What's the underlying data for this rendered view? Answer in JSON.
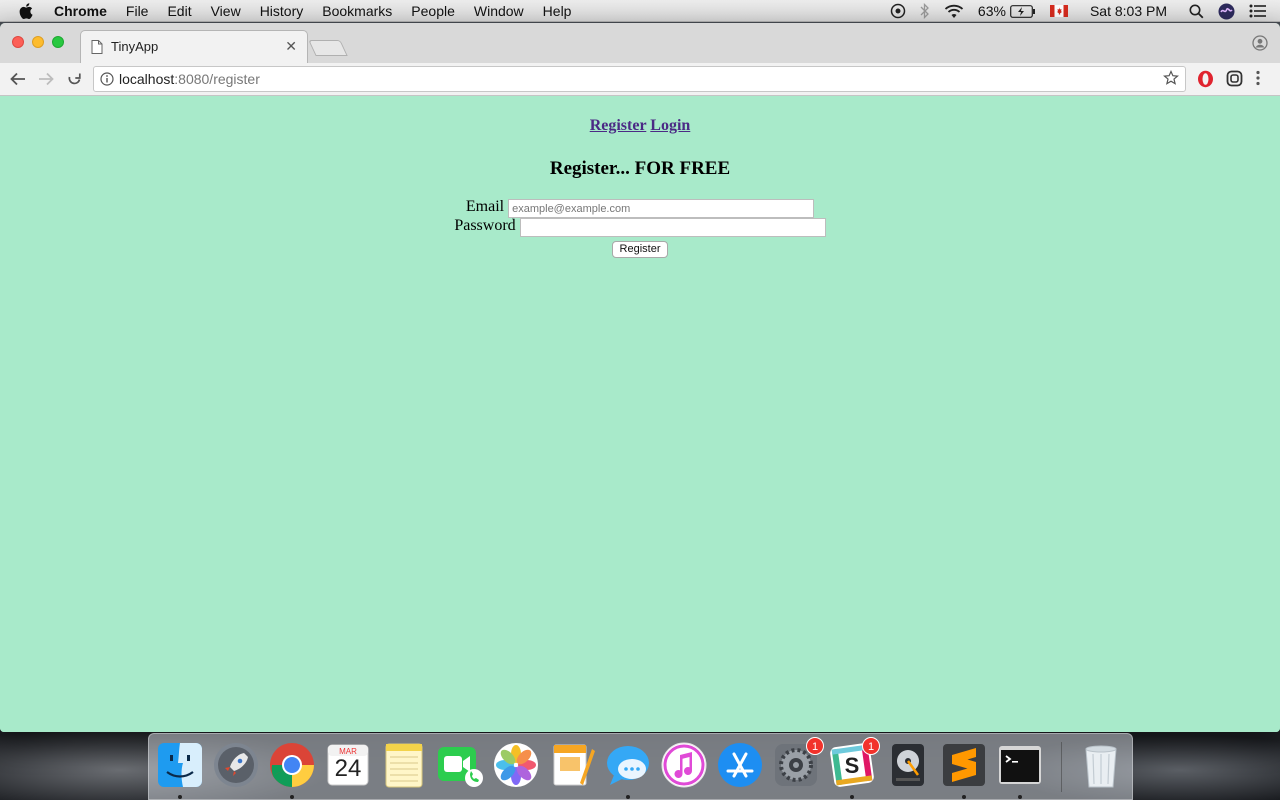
{
  "menubar": {
    "app_name": "Chrome",
    "items": [
      "File",
      "Edit",
      "View",
      "History",
      "Bookmarks",
      "People",
      "Window",
      "Help"
    ],
    "battery": "63%",
    "clock": "Sat 8:03 PM"
  },
  "browser": {
    "tab_title": "TinyApp",
    "url_host": "localhost",
    "url_path": ":8080/register"
  },
  "page": {
    "nav": {
      "register_link": "Register",
      "login_link": "Login"
    },
    "heading": "Register... FOR FREE",
    "form": {
      "email_label": "Email",
      "email_placeholder": "example@example.com",
      "email_value": "",
      "password_label": "Password",
      "password_value": "",
      "submit_label": "Register"
    }
  },
  "dock": {
    "calendar_month": "MAR",
    "calendar_day": "24",
    "badges": {
      "system_preferences": "1",
      "slack": "1"
    },
    "items": [
      {
        "name": "finder-icon",
        "running": true
      },
      {
        "name": "launchpad-icon",
        "running": false
      },
      {
        "name": "chrome-icon",
        "running": true
      },
      {
        "name": "calendar-icon",
        "running": false
      },
      {
        "name": "notes-icon",
        "running": false
      },
      {
        "name": "facetime-icon",
        "running": false
      },
      {
        "name": "photos-icon",
        "running": false
      },
      {
        "name": "pages-icon",
        "running": false
      },
      {
        "name": "messages-icon",
        "running": true
      },
      {
        "name": "itunes-icon",
        "running": false
      },
      {
        "name": "app-store-icon",
        "running": false
      },
      {
        "name": "system-preferences-icon",
        "running": false
      },
      {
        "name": "slack-icon",
        "running": true
      },
      {
        "name": "disk-utility-icon",
        "running": false
      },
      {
        "name": "sublime-text-icon",
        "running": true
      },
      {
        "name": "terminal-icon",
        "running": true
      },
      {
        "name": "trash-icon",
        "running": false
      }
    ]
  },
  "colors": {
    "page_background": "#a8eaca",
    "link": "#4b2a85"
  }
}
